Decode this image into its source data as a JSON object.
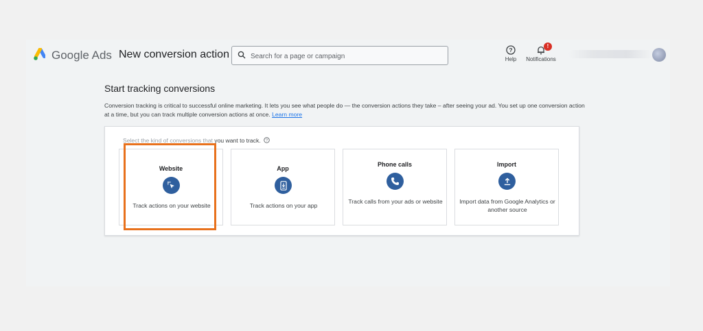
{
  "header": {
    "brand": "Google Ads",
    "page_title": "New conversion action",
    "search_placeholder": "Search for a page or campaign",
    "help_label": "Help",
    "notifications_label": "Notifications",
    "notifications_badge": "!"
  },
  "main": {
    "section_title": "Start tracking conversions",
    "description": "Conversion tracking is critical to successful online marketing. It lets you see what people do — the conversion actions they take – after seeing your ad. You set up one conversion action at a time, but you can track multiple conversion actions at once.",
    "learn_more": "Learn more",
    "prompt_faded": "Select the kind of conversions that",
    "prompt_visible": "you want to track.",
    "options": [
      {
        "title": "Website",
        "icon": "cursor-click-icon",
        "description": "Track actions on your website"
      },
      {
        "title": "App",
        "icon": "mobile-download-icon",
        "description": "Track actions on your app"
      },
      {
        "title": "Phone calls",
        "icon": "phone-icon",
        "description": "Track calls from your ads or website"
      },
      {
        "title": "Import",
        "icon": "upload-icon",
        "description": "Import data from Google Analytics or another source"
      }
    ]
  },
  "colors": {
    "accent_blue": "#2f5f9e",
    "link_blue": "#1a73e8",
    "highlight_orange": "#e8711c",
    "badge_red": "#d93025"
  }
}
